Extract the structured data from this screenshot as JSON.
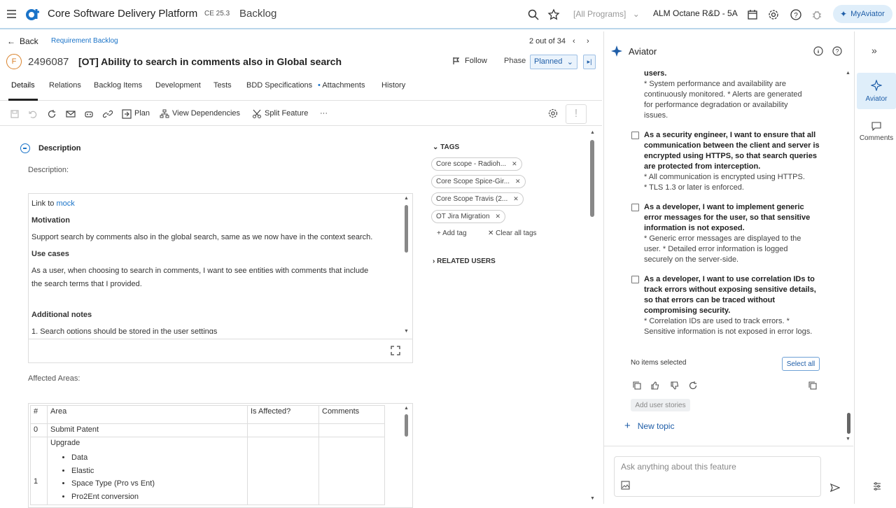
{
  "header": {
    "app_title": "Core Software Delivery Platform",
    "version": "CE 25.3",
    "module": "Backlog",
    "programs": "[All Programs]",
    "workspace": "ALM Octane R&D - 5A",
    "my_aviator": "MyAviator"
  },
  "nav": {
    "back": "Back",
    "breadcrumb": "Requirement Backlog",
    "pager": "2 out of 34"
  },
  "item": {
    "type_badge": "F",
    "id": "2496087",
    "title": "[OT] Ability to search in comments also in Global search",
    "follow": "Follow",
    "phase_label": "Phase",
    "phase_value": "Planned"
  },
  "tabs": [
    "Details",
    "Relations",
    "Backlog Items",
    "Development",
    "Tests",
    "BDD Specifications",
    "Attachments",
    "History"
  ],
  "toolbar": {
    "plan": "Plan",
    "view_dependencies": "View Dependencies",
    "split_feature": "Split Feature",
    "more": "···"
  },
  "details": {
    "section_title": "Description",
    "description_label": "Description:",
    "link_prefix": "Link to ",
    "link_text": "mock",
    "motivation_h": "Motivation",
    "motivation": "Support search by comments also in the global search, same as we now have in the context search.",
    "usecases_h": "Use cases",
    "usecase_1": "As a user, when choosing to search in comments, I want to see entities with comments that include",
    "usecase_2": "the search terms that I provided.",
    "notes_h": "Additional notes",
    "note_1": "1. Search options should be stored in the user settings",
    "affected_label": "Affected Areas:"
  },
  "table": {
    "headers": [
      "#",
      "Area",
      "Is Affected?",
      "Comments"
    ],
    "row0": [
      "0",
      "Submit Patent"
    ],
    "row1_num": "1",
    "row1_area": "Upgrade",
    "row1_bullets": [
      "Data",
      "Elastic",
      "Space Type (Pro vs Ent)",
      "Pro2Ent conversion"
    ]
  },
  "tags": {
    "header": "TAGS",
    "items": [
      "Core scope - Radioh...",
      "Core Scope Spice-Gir...",
      "Core Scope Travis (2...",
      "OT Jira Migration"
    ],
    "add": "Add tag",
    "clear": "Clear all tags",
    "related": "RELATED USERS"
  },
  "aviator": {
    "title": "Aviator",
    "top_users": "users.",
    "top_text": "* System performance and availability are continuously monitored. * Alerts are generated for performance degradation or availability issues.",
    "stories": [
      {
        "title": "As a security engineer, I want to ensure that all communication between the client and server is encrypted using HTTPS, so that search queries are protected from interception.",
        "criteria": [
          "* All communication is encrypted using HTTPS.",
          "* TLS 1.3 or later is enforced."
        ]
      },
      {
        "title": "As a developer, I want to implement generic error messages for the user, so that sensitive information is not exposed.",
        "criteria": [
          "* Generic error messages are displayed to the user. * Detailed error information is logged securely on the server-side."
        ]
      },
      {
        "title": "As a developer, I want to use correlation IDs to track errors without exposing sensitive details, so that errors can be traced without compromising security.",
        "criteria": [
          "* Correlation IDs are used to track errors. * Sensitive information is not exposed in error logs."
        ]
      }
    ],
    "no_items": "No items selected",
    "select_all": "Select all",
    "add_user_stories": "Add user stories",
    "new_topic": "New topic",
    "ask_placeholder": "Ask anything about this feature"
  },
  "rail": {
    "aviator": "Aviator",
    "comments": "Comments"
  }
}
